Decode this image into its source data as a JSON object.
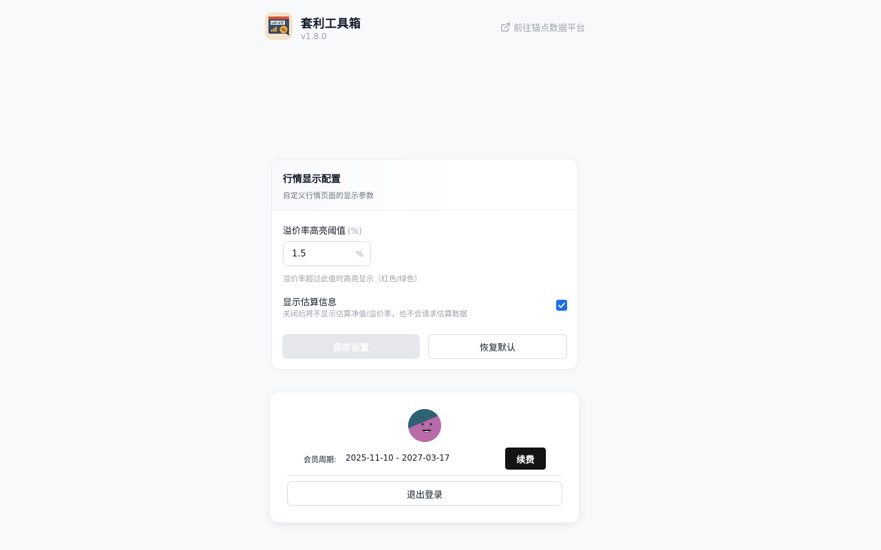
{
  "header": {
    "title": "套利工具箱",
    "version": "v1.8.0",
    "external_link_label": "前往锚点数据平台",
    "app_icon": "lof-etf-chart-icon",
    "app_icon_text": "LOF-ETF"
  },
  "config": {
    "title": "行情显示配置",
    "subtitle": "自定义行情页面的显示参数",
    "threshold": {
      "label": "溢价率高亮阈值",
      "unit_label": "(%)",
      "value": "1.5",
      "suffix": "%",
      "hint": "溢价率超过此值时高亮显示（红色/绿色）"
    },
    "estimate": {
      "label": "显示估算信息",
      "hint": "关闭后将不显示估算净值/溢价率，也不会请求估算数据",
      "checked": true
    },
    "save_label": "保存设置",
    "reset_label": "恢复默认"
  },
  "member": {
    "avatar_icon": "smiley-avatar",
    "period_label": "会员周期:",
    "period_value": "2025-11-10 - 2027-03-17",
    "renew_label": "续费",
    "logout_label": "退出登录"
  },
  "colors": {
    "accent": "#1f6feb",
    "avatar_purple": "#b86aa9",
    "avatar_teal": "#2d6275"
  }
}
